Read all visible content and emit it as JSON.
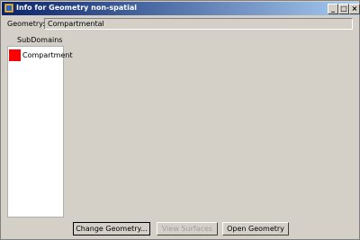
{
  "window": {
    "title": "Info for Geometry non-spatial",
    "controls": {
      "minimize": "_",
      "maximize": "□",
      "close": "×"
    }
  },
  "geometry": {
    "label": "Geometry:",
    "value": "Compartmental"
  },
  "subdomains": {
    "label": "SubDomains",
    "items": [
      {
        "name": "Compartment",
        "color": "#ff0000"
      }
    ]
  },
  "buttons": {
    "change_geometry": "Change Geometry...",
    "view_surfaces": "View Surfaces",
    "open_geometry": "Open Geometry"
  }
}
